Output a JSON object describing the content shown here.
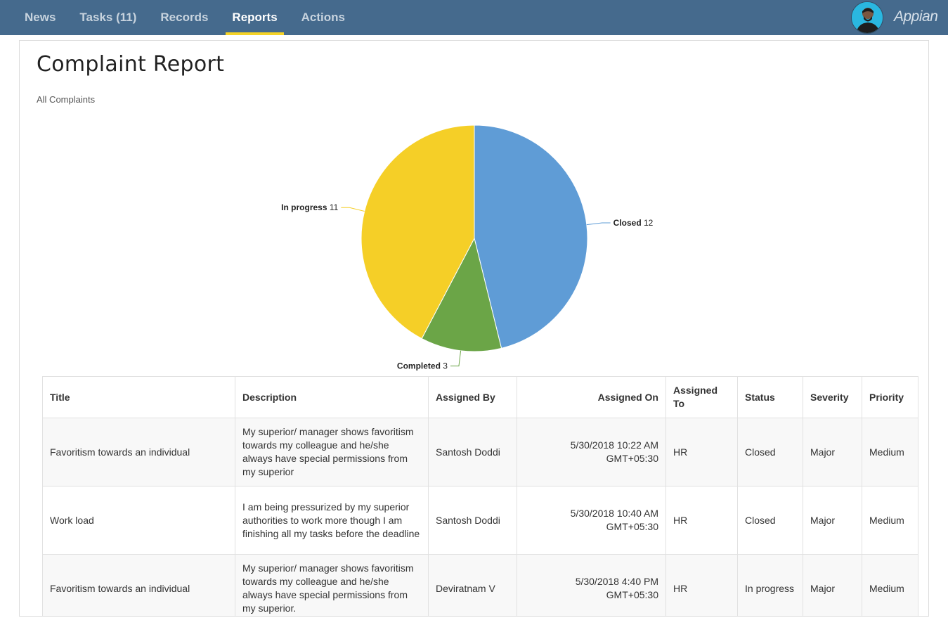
{
  "nav": {
    "items": [
      {
        "label": "News"
      },
      {
        "label": "Tasks (11)"
      },
      {
        "label": "Records"
      },
      {
        "label": "Reports"
      },
      {
        "label": "Actions"
      }
    ],
    "active_index": 3,
    "accent_color": "#f5d327",
    "bar_color": "#456a8d"
  },
  "brand": {
    "logo_text": "Appian"
  },
  "page": {
    "title": "Complaint Report"
  },
  "chart_data": {
    "type": "pie",
    "title": "All Complaints",
    "slices": [
      {
        "label": "Closed",
        "value": 12,
        "color": "#5f9cd6"
      },
      {
        "label": "Completed",
        "value": 3,
        "color": "#6ba547"
      },
      {
        "label": "In progress",
        "value": 11,
        "color": "#f5cf27"
      }
    ]
  },
  "table": {
    "headers": [
      "Title",
      "Description",
      "Assigned By",
      "Assigned On",
      "Assigned To",
      "Status",
      "Severity",
      "Priority"
    ],
    "rows": [
      {
        "title": "Favoritism towards an individual",
        "description": "My superior/ manager shows favoritism towards my colleague and he/she always have special permissions from my superior",
        "assigned_by": "Santosh Doddi",
        "assigned_on": "5/30/2018 10:22 AM GMT+05:30",
        "assigned_to": "HR",
        "status": "Closed",
        "severity": "Major",
        "priority": "Medium"
      },
      {
        "title": "Work load",
        "description": "I am being pressurized by my superior authorities  to work more though I am finishing all my tasks before the deadline",
        "assigned_by": "Santosh Doddi",
        "assigned_on": "5/30/2018 10:40 AM GMT+05:30",
        "assigned_to": "HR",
        "status": "Closed",
        "severity": "Major",
        "priority": "Medium"
      },
      {
        "title": "Favoritism towards an individual",
        "description": "My superior/ manager shows favoritism towards my colleague and he/she always have special permissions from my superior.",
        "assigned_by": "Deviratnam V",
        "assigned_on": "5/30/2018 4:40 PM GMT+05:30",
        "assigned_to": "HR",
        "status": "In progress",
        "severity": "Major",
        "priority": "Medium"
      }
    ]
  }
}
